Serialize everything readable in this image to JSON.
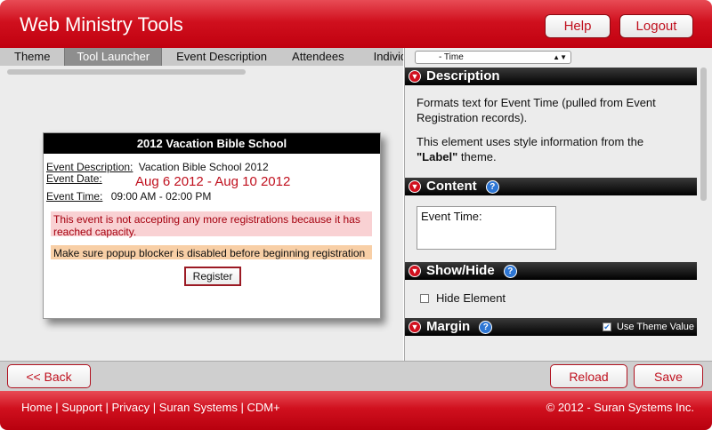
{
  "header": {
    "title": "Web Ministry Tools",
    "help_label": "Help",
    "logout_label": "Logout"
  },
  "tabs": [
    {
      "label": "Theme",
      "active": false
    },
    {
      "label": "Tool Launcher",
      "active": true
    },
    {
      "label": "Event Description",
      "active": false
    },
    {
      "label": "Attendees",
      "active": false
    },
    {
      "label": "Individual L",
      "active": false
    }
  ],
  "preview": {
    "title": "2012 Vacation Bible School",
    "desc_label": "Event Description:",
    "desc_value": "Vacation Bible School 2012",
    "date_label": "Event Date:",
    "date_value": "Aug 6 2012 - Aug 10 2012",
    "time_label": "Event Time:",
    "time_value": "09:00 AM - 02:00 PM",
    "capacity_msg": "This event is not accepting any more registrations because it has reached capacity.",
    "popup_msg": "Make sure popup blocker is disabled before beginning registration",
    "register_label": "Register"
  },
  "properties": {
    "element_select": "- Time",
    "description_header": "Description",
    "description_p1": "Formats text for Event Time (pulled from Event Registration records).",
    "description_p2_pre": "This element uses style information from the ",
    "description_p2_bold": "\"Label\"",
    "description_p2_post": " theme.",
    "content_header": "Content",
    "content_value": "Event Time:",
    "showhide_header": "Show/Hide",
    "hide_label": "Hide Element",
    "margin_header": "Margin",
    "use_theme_label": "Use Theme Value"
  },
  "bottom": {
    "back_label": "<< Back",
    "reload_label": "Reload",
    "save_label": "Save"
  },
  "footer": {
    "links": [
      "Home",
      "Support",
      "Privacy",
      "Suran Systems",
      "CDM+"
    ],
    "copyright": "© 2012 - Suran Systems Inc."
  }
}
